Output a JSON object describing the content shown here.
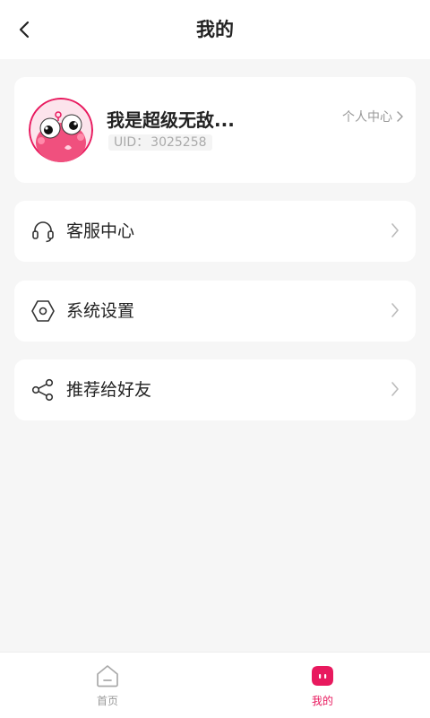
{
  "header": {
    "title": "我的"
  },
  "profile": {
    "username": "我是超级无敌...",
    "uid_label": "UID：",
    "uid_value": "3025258",
    "center_link": "个人中心"
  },
  "menu": [
    {
      "label": "客服中心",
      "icon": "headset-icon"
    },
    {
      "label": "系统设置",
      "icon": "settings-hexagon-icon"
    },
    {
      "label": "推荐给好友",
      "icon": "share-icon"
    }
  ],
  "tabbar": {
    "items": [
      {
        "label": "首页",
        "icon": "home-icon",
        "active": false
      },
      {
        "label": "我的",
        "icon": "mine-icon",
        "active": true
      }
    ]
  },
  "colors": {
    "accent": "#e8195e",
    "background": "#f6f6f6",
    "card": "#ffffff"
  }
}
